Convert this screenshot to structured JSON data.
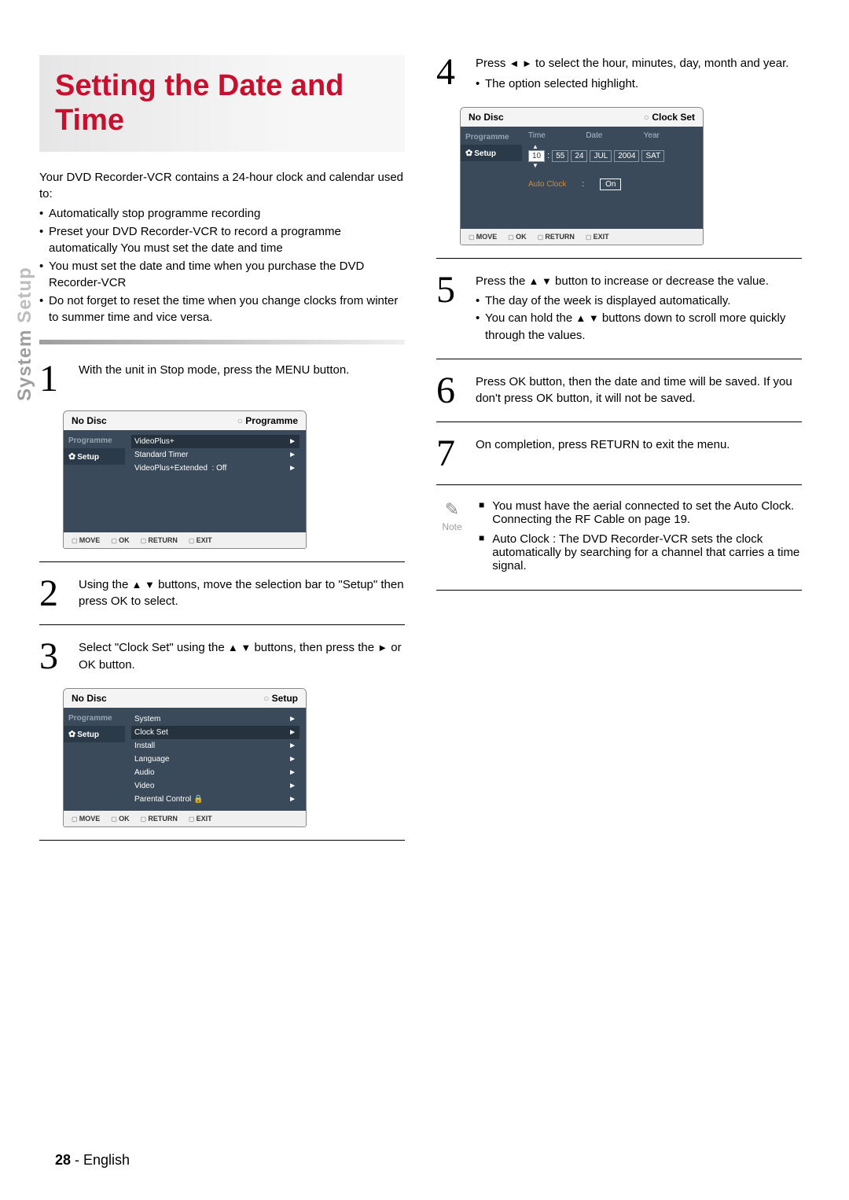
{
  "sidetab": {
    "prefix": "System ",
    "word": "Setup"
  },
  "title": "Setting the Date and Time",
  "intro": {
    "lead": "Your DVD Recorder-VCR contains a 24-hour clock and calendar used to:",
    "items": [
      "Automatically stop programme recording",
      "Preset your DVD Recorder-VCR to record a programme automatically You must set the date and time",
      "You must set the date and time when you purchase the DVD Recorder-VCR",
      "Do not forget to reset the time when you change clocks from winter to summer time and vice versa."
    ]
  },
  "steps": {
    "s1": {
      "num": "1",
      "text": "With the unit in Stop mode, press the MENU button."
    },
    "s2": {
      "num": "2",
      "pre": "Using the ",
      "arrows": "▲ ▼",
      "post": " buttons, move the selection bar to \"Setup\" then press OK to select."
    },
    "s3": {
      "num": "3",
      "pre": "Select \"Clock Set\" using the ",
      "arrows": "▲ ▼",
      "post": " buttons, then press the ",
      "arrow2": "►",
      "post2": " or OK button."
    },
    "s4": {
      "num": "4",
      "pre": "Press ",
      "arrows": "◄ ►",
      "post": " to select the hour, minutes, day, month and year.",
      "bullet": "The option selected highlight."
    },
    "s5": {
      "num": "5",
      "pre": "Press the ",
      "arrows": "▲ ▼",
      "post": " button to increase or decrease the value.",
      "b1": "The day of the week is displayed automatically.",
      "b2pre": "You can hold the ",
      "b2arrows": "▲ ▼",
      "b2post": " buttons down to scroll more quickly through the values."
    },
    "s6": {
      "num": "6",
      "text": "Press OK button, then the date and time will be saved. If you don't press OK button, it will not be saved."
    },
    "s7": {
      "num": "7",
      "text": "On completion, press RETURN to exit the menu."
    }
  },
  "osd_labels": {
    "no_disc": "No Disc",
    "programme": "Programme",
    "setup": "Setup",
    "clock_set": "Clock Set",
    "move": "MOVE",
    "ok": "OK",
    "return": "RETURN",
    "exit": "EXIT"
  },
  "osd1": {
    "mode": "Programme",
    "items": [
      {
        "label": "VideoPlus+",
        "val": "",
        "sel": true
      },
      {
        "label": "Standard Timer",
        "val": ""
      },
      {
        "label": "VideoPlus+Extended",
        "val": ": Off"
      }
    ]
  },
  "osd2": {
    "mode": "Setup",
    "items": [
      {
        "label": "System"
      },
      {
        "label": "Clock Set",
        "sel": true
      },
      {
        "label": "Install"
      },
      {
        "label": "Language"
      },
      {
        "label": "Audio"
      },
      {
        "label": "Video"
      },
      {
        "label": "Parental Control",
        "lock": true
      }
    ]
  },
  "osd3": {
    "mode": "Clock Set",
    "cols": {
      "time": "Time",
      "date": "Date",
      "year": "Year"
    },
    "vals": {
      "h": "10",
      "m": "55",
      "d": "24",
      "mon": "JUL",
      "y": "2004",
      "dow": "SAT"
    },
    "auto_label": "Auto Clock",
    "auto_val": "On"
  },
  "note": {
    "icon": "✎",
    "label": "Note",
    "items": [
      "You must have the aerial connected to set the Auto Clock. Connecting the RF Cable on page 19.",
      "Auto Clock : The DVD Recorder-VCR sets the clock automatically by searching for a channel that carries a time signal."
    ]
  },
  "footer": {
    "page": "28",
    "lang": "English"
  }
}
